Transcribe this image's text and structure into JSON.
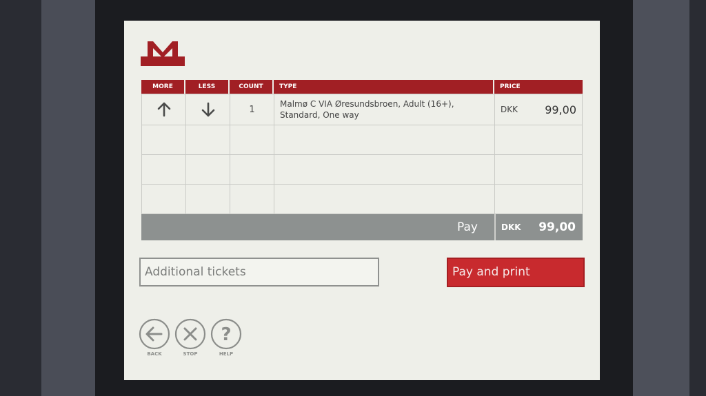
{
  "brand": {
    "logo_letter": "M",
    "color": "#a11f24"
  },
  "table": {
    "headers": {
      "more": "MORE",
      "less": "LESS",
      "count": "COUNT",
      "type": "TYPE",
      "price": "PRICE"
    },
    "rows": [
      {
        "more_icon": "arrow-up-icon",
        "less_icon": "arrow-down-icon",
        "count": "1",
        "type_line1": "Malmø C VIA Øresundsbroen, Adult (16+),",
        "type_line2": "Standard, One way",
        "currency": "DKK",
        "price": "99,00"
      }
    ]
  },
  "total": {
    "label": "Pay",
    "currency": "DKK",
    "amount": "99,00"
  },
  "actions": {
    "additional_tickets": "Additional tickets",
    "pay_and_print": "Pay and print"
  },
  "nav": {
    "back": {
      "label": "BACK",
      "icon": "back-arrow-icon"
    },
    "stop": {
      "label": "STOP",
      "icon": "stop-x-icon"
    },
    "help": {
      "label": "HELP",
      "icon": "help-question-icon"
    }
  },
  "colors": {
    "accent_red": "#c82a2e",
    "header_red": "#a11f24",
    "pay_bar_grey": "#8d9190"
  }
}
